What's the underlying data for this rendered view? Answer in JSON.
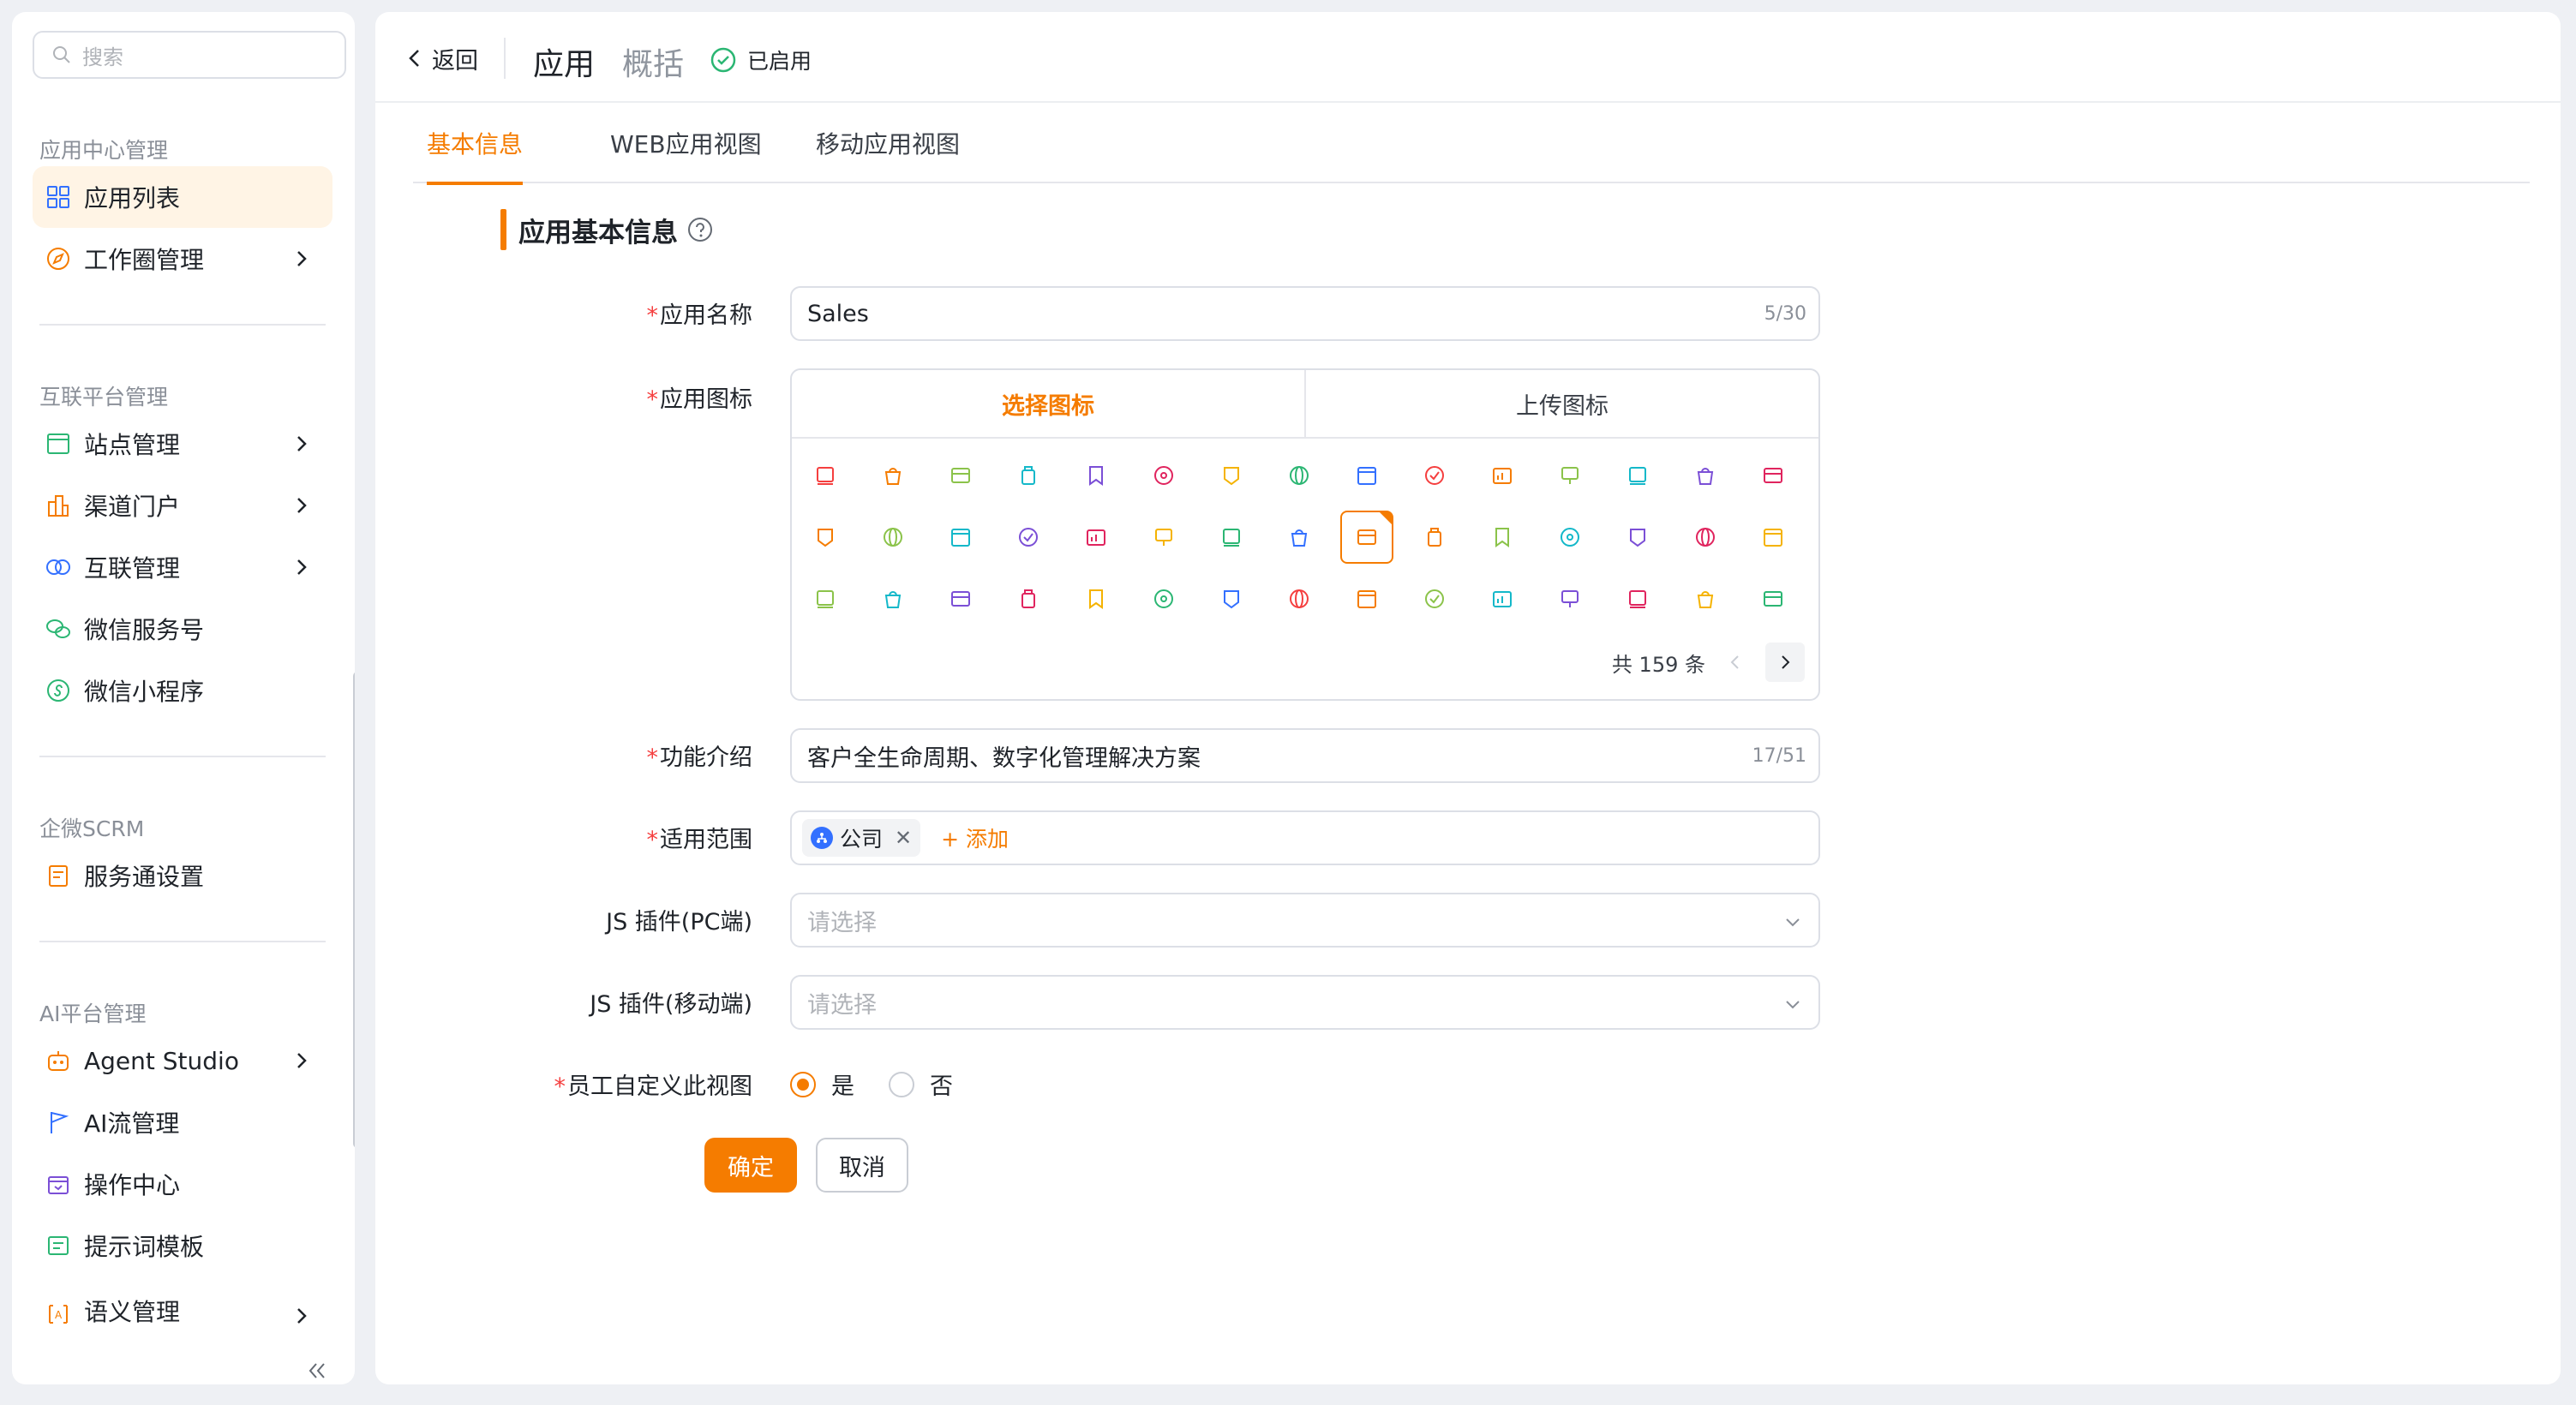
{
  "sidebar": {
    "search_placeholder": "搜索",
    "sections": [
      {
        "title": "应用中心管理"
      },
      {
        "title": "互联平台管理"
      },
      {
        "title": "企微SCRM"
      },
      {
        "title": "AI平台管理"
      }
    ],
    "items": [
      {
        "label": "应用列表",
        "icon": "grid-icon",
        "active": true
      },
      {
        "label": "工作圈管理",
        "icon": "compass-icon"
      },
      {
        "label": "站点管理",
        "icon": "window-icon"
      },
      {
        "label": "渠道门户",
        "icon": "building-icon"
      },
      {
        "label": "互联管理",
        "icon": "link-rings-icon"
      },
      {
        "label": "微信服务号",
        "icon": "wechat-icon"
      },
      {
        "label": "微信小程序",
        "icon": "mini-program-icon"
      },
      {
        "label": "服务通设置",
        "icon": "service-icon"
      },
      {
        "label": "Agent Studio",
        "icon": "robot-icon"
      },
      {
        "label": "AI流管理",
        "icon": "flag-icon"
      },
      {
        "label": "操作中心",
        "icon": "store-icon"
      },
      {
        "label": "提示词模板",
        "icon": "template-icon"
      },
      {
        "label": "语义管理",
        "icon": "semantic-icon"
      }
    ]
  },
  "header": {
    "back_label": "返回",
    "app_title": "应用",
    "overview_label": "概括",
    "status_label": "已启用"
  },
  "tabs": [
    {
      "label": "基本信息",
      "active": true
    },
    {
      "label": "WEB应用视图"
    },
    {
      "label": "移动应用视图"
    }
  ],
  "form": {
    "section_title": "应用基本信息",
    "name": {
      "label": "应用名称",
      "value": "Sales",
      "count": "5/30"
    },
    "icon": {
      "label": "应用图标",
      "tab_select": "选择图标",
      "tab_upload": "上传图标",
      "total": "共 159 条",
      "selected_index": 23
    },
    "intro": {
      "label": "功能介绍",
      "value": "客户全生命周期、数字化管理解决方案",
      "count": "17/51"
    },
    "scope": {
      "label": "适用范围",
      "tag": "公司",
      "add_label": "+ 添加"
    },
    "js_pc": {
      "label": "JS 插件(PC端)",
      "placeholder": "请选择"
    },
    "js_mobile": {
      "label": "JS 插件(移动端)",
      "placeholder": "请选择"
    },
    "custom_view": {
      "label": "员工自定义此视图",
      "yes": "是",
      "no": "否",
      "selected": "yes"
    },
    "confirm_label": "确定",
    "cancel_label": "取消"
  },
  "colors": {
    "accent": "#f57c00",
    "required": "#f53f3f",
    "success": "#2bb673"
  }
}
